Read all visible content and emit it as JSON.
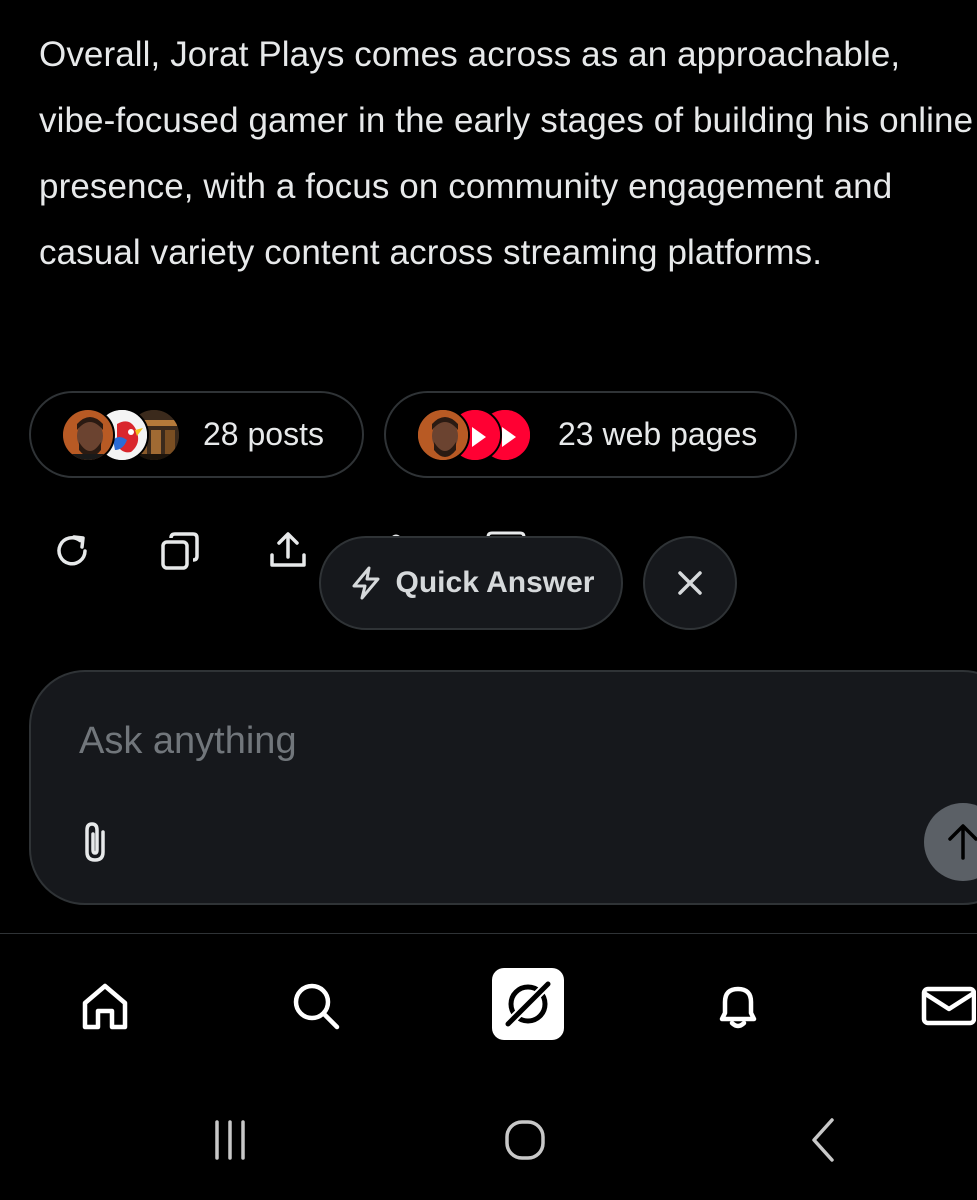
{
  "answer": {
    "text": "Overall, Jorat Plays comes across as an approachable, vibe-focused gamer in the early stages of building his online presence, with a focus on community engagement and casual variety content across streaming platforms."
  },
  "sources": {
    "posts_label": "28 posts",
    "web_label": "23 web pages"
  },
  "popover": {
    "quick_answer_label": "Quick Answer"
  },
  "composer": {
    "placeholder": "Ask anything"
  },
  "icons": {
    "actions": [
      "refresh-icon",
      "copy-icon",
      "share-icon"
    ],
    "nav": [
      "home-icon",
      "search-icon",
      "grok-icon",
      "bell-icon",
      "mail-icon"
    ],
    "system_nav": [
      "recents-icon",
      "home-circle-icon",
      "back-icon"
    ]
  },
  "colors": {
    "background": "#000000",
    "surface": "#16181c",
    "border": "#2f3336",
    "text": "#e7e9ea",
    "muted": "#71767b",
    "youtube_red": "#ff0033"
  }
}
